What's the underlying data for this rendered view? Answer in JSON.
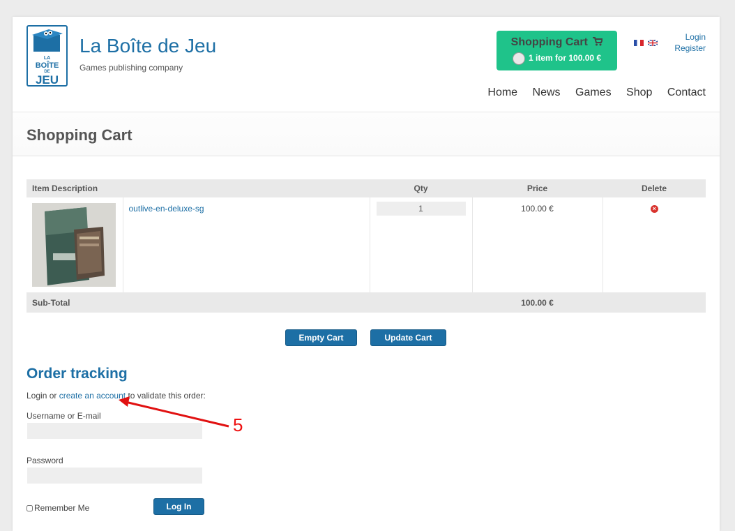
{
  "site": {
    "title": "La Boîte de Jeu",
    "tagline": "Games publishing company",
    "logo_text": [
      "LA",
      "BOÎTE",
      "DE",
      "JEU"
    ]
  },
  "cart_widget": {
    "title": "Shopping Cart",
    "summary": "1 item for 100.00 €"
  },
  "languages": [
    "fr-flag-icon",
    "uk-flag-icon"
  ],
  "auth": {
    "login": "Login",
    "register": "Register"
  },
  "nav": [
    "Home",
    "News",
    "Games",
    "Shop",
    "Contact"
  ],
  "page_title": "Shopping Cart",
  "cart_table": {
    "headers": {
      "description": "Item Description",
      "qty": "Qty",
      "price": "Price",
      "delete": "Delete"
    },
    "rows": [
      {
        "name": "outlive-en-deluxe-sg",
        "qty": "1",
        "price": "100.00 €"
      }
    ],
    "subtotal_label": "Sub-Total",
    "subtotal_value": "100.00 €"
  },
  "buttons": {
    "empty_cart": "Empty Cart",
    "update_cart": "Update Cart",
    "login": "Log In"
  },
  "order_tracking": {
    "title": "Order tracking",
    "intro_before": "Login or ",
    "intro_link": "create an account",
    "intro_after": " to validate this order:",
    "username_label": "Username or E-mail",
    "password_label": "Password",
    "remember_label": "Remember Me"
  },
  "annotation": {
    "number": "5",
    "color": "#e11111"
  },
  "colors": {
    "brand_blue": "#1d6fa5",
    "cart_green": "#1fc38a",
    "delete_red": "#d9332e"
  }
}
